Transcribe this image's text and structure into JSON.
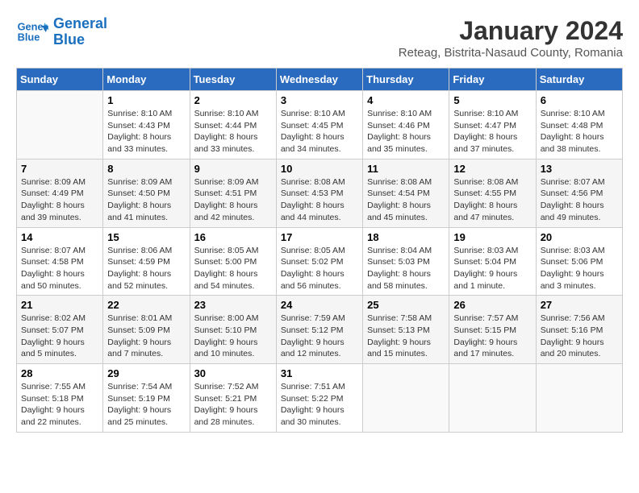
{
  "logo": {
    "line1": "General",
    "line2": "Blue"
  },
  "title": "January 2024",
  "subtitle": "Reteag, Bistrita-Nasaud County, Romania",
  "days_of_week": [
    "Sunday",
    "Monday",
    "Tuesday",
    "Wednesday",
    "Thursday",
    "Friday",
    "Saturday"
  ],
  "weeks": [
    [
      {
        "day": "",
        "info": ""
      },
      {
        "day": "1",
        "info": "Sunrise: 8:10 AM\nSunset: 4:43 PM\nDaylight: 8 hours\nand 33 minutes."
      },
      {
        "day": "2",
        "info": "Sunrise: 8:10 AM\nSunset: 4:44 PM\nDaylight: 8 hours\nand 33 minutes."
      },
      {
        "day": "3",
        "info": "Sunrise: 8:10 AM\nSunset: 4:45 PM\nDaylight: 8 hours\nand 34 minutes."
      },
      {
        "day": "4",
        "info": "Sunrise: 8:10 AM\nSunset: 4:46 PM\nDaylight: 8 hours\nand 35 minutes."
      },
      {
        "day": "5",
        "info": "Sunrise: 8:10 AM\nSunset: 4:47 PM\nDaylight: 8 hours\nand 37 minutes."
      },
      {
        "day": "6",
        "info": "Sunrise: 8:10 AM\nSunset: 4:48 PM\nDaylight: 8 hours\nand 38 minutes."
      }
    ],
    [
      {
        "day": "7",
        "info": "Sunrise: 8:09 AM\nSunset: 4:49 PM\nDaylight: 8 hours\nand 39 minutes."
      },
      {
        "day": "8",
        "info": "Sunrise: 8:09 AM\nSunset: 4:50 PM\nDaylight: 8 hours\nand 41 minutes."
      },
      {
        "day": "9",
        "info": "Sunrise: 8:09 AM\nSunset: 4:51 PM\nDaylight: 8 hours\nand 42 minutes."
      },
      {
        "day": "10",
        "info": "Sunrise: 8:08 AM\nSunset: 4:53 PM\nDaylight: 8 hours\nand 44 minutes."
      },
      {
        "day": "11",
        "info": "Sunrise: 8:08 AM\nSunset: 4:54 PM\nDaylight: 8 hours\nand 45 minutes."
      },
      {
        "day": "12",
        "info": "Sunrise: 8:08 AM\nSunset: 4:55 PM\nDaylight: 8 hours\nand 47 minutes."
      },
      {
        "day": "13",
        "info": "Sunrise: 8:07 AM\nSunset: 4:56 PM\nDaylight: 8 hours\nand 49 minutes."
      }
    ],
    [
      {
        "day": "14",
        "info": "Sunrise: 8:07 AM\nSunset: 4:58 PM\nDaylight: 8 hours\nand 50 minutes."
      },
      {
        "day": "15",
        "info": "Sunrise: 8:06 AM\nSunset: 4:59 PM\nDaylight: 8 hours\nand 52 minutes."
      },
      {
        "day": "16",
        "info": "Sunrise: 8:05 AM\nSunset: 5:00 PM\nDaylight: 8 hours\nand 54 minutes."
      },
      {
        "day": "17",
        "info": "Sunrise: 8:05 AM\nSunset: 5:02 PM\nDaylight: 8 hours\nand 56 minutes."
      },
      {
        "day": "18",
        "info": "Sunrise: 8:04 AM\nSunset: 5:03 PM\nDaylight: 8 hours\nand 58 minutes."
      },
      {
        "day": "19",
        "info": "Sunrise: 8:03 AM\nSunset: 5:04 PM\nDaylight: 9 hours\nand 1 minute."
      },
      {
        "day": "20",
        "info": "Sunrise: 8:03 AM\nSunset: 5:06 PM\nDaylight: 9 hours\nand 3 minutes."
      }
    ],
    [
      {
        "day": "21",
        "info": "Sunrise: 8:02 AM\nSunset: 5:07 PM\nDaylight: 9 hours\nand 5 minutes."
      },
      {
        "day": "22",
        "info": "Sunrise: 8:01 AM\nSunset: 5:09 PM\nDaylight: 9 hours\nand 7 minutes."
      },
      {
        "day": "23",
        "info": "Sunrise: 8:00 AM\nSunset: 5:10 PM\nDaylight: 9 hours\nand 10 minutes."
      },
      {
        "day": "24",
        "info": "Sunrise: 7:59 AM\nSunset: 5:12 PM\nDaylight: 9 hours\nand 12 minutes."
      },
      {
        "day": "25",
        "info": "Sunrise: 7:58 AM\nSunset: 5:13 PM\nDaylight: 9 hours\nand 15 minutes."
      },
      {
        "day": "26",
        "info": "Sunrise: 7:57 AM\nSunset: 5:15 PM\nDaylight: 9 hours\nand 17 minutes."
      },
      {
        "day": "27",
        "info": "Sunrise: 7:56 AM\nSunset: 5:16 PM\nDaylight: 9 hours\nand 20 minutes."
      }
    ],
    [
      {
        "day": "28",
        "info": "Sunrise: 7:55 AM\nSunset: 5:18 PM\nDaylight: 9 hours\nand 22 minutes."
      },
      {
        "day": "29",
        "info": "Sunrise: 7:54 AM\nSunset: 5:19 PM\nDaylight: 9 hours\nand 25 minutes."
      },
      {
        "day": "30",
        "info": "Sunrise: 7:52 AM\nSunset: 5:21 PM\nDaylight: 9 hours\nand 28 minutes."
      },
      {
        "day": "31",
        "info": "Sunrise: 7:51 AM\nSunset: 5:22 PM\nDaylight: 9 hours\nand 30 minutes."
      },
      {
        "day": "",
        "info": ""
      },
      {
        "day": "",
        "info": ""
      },
      {
        "day": "",
        "info": ""
      }
    ]
  ]
}
